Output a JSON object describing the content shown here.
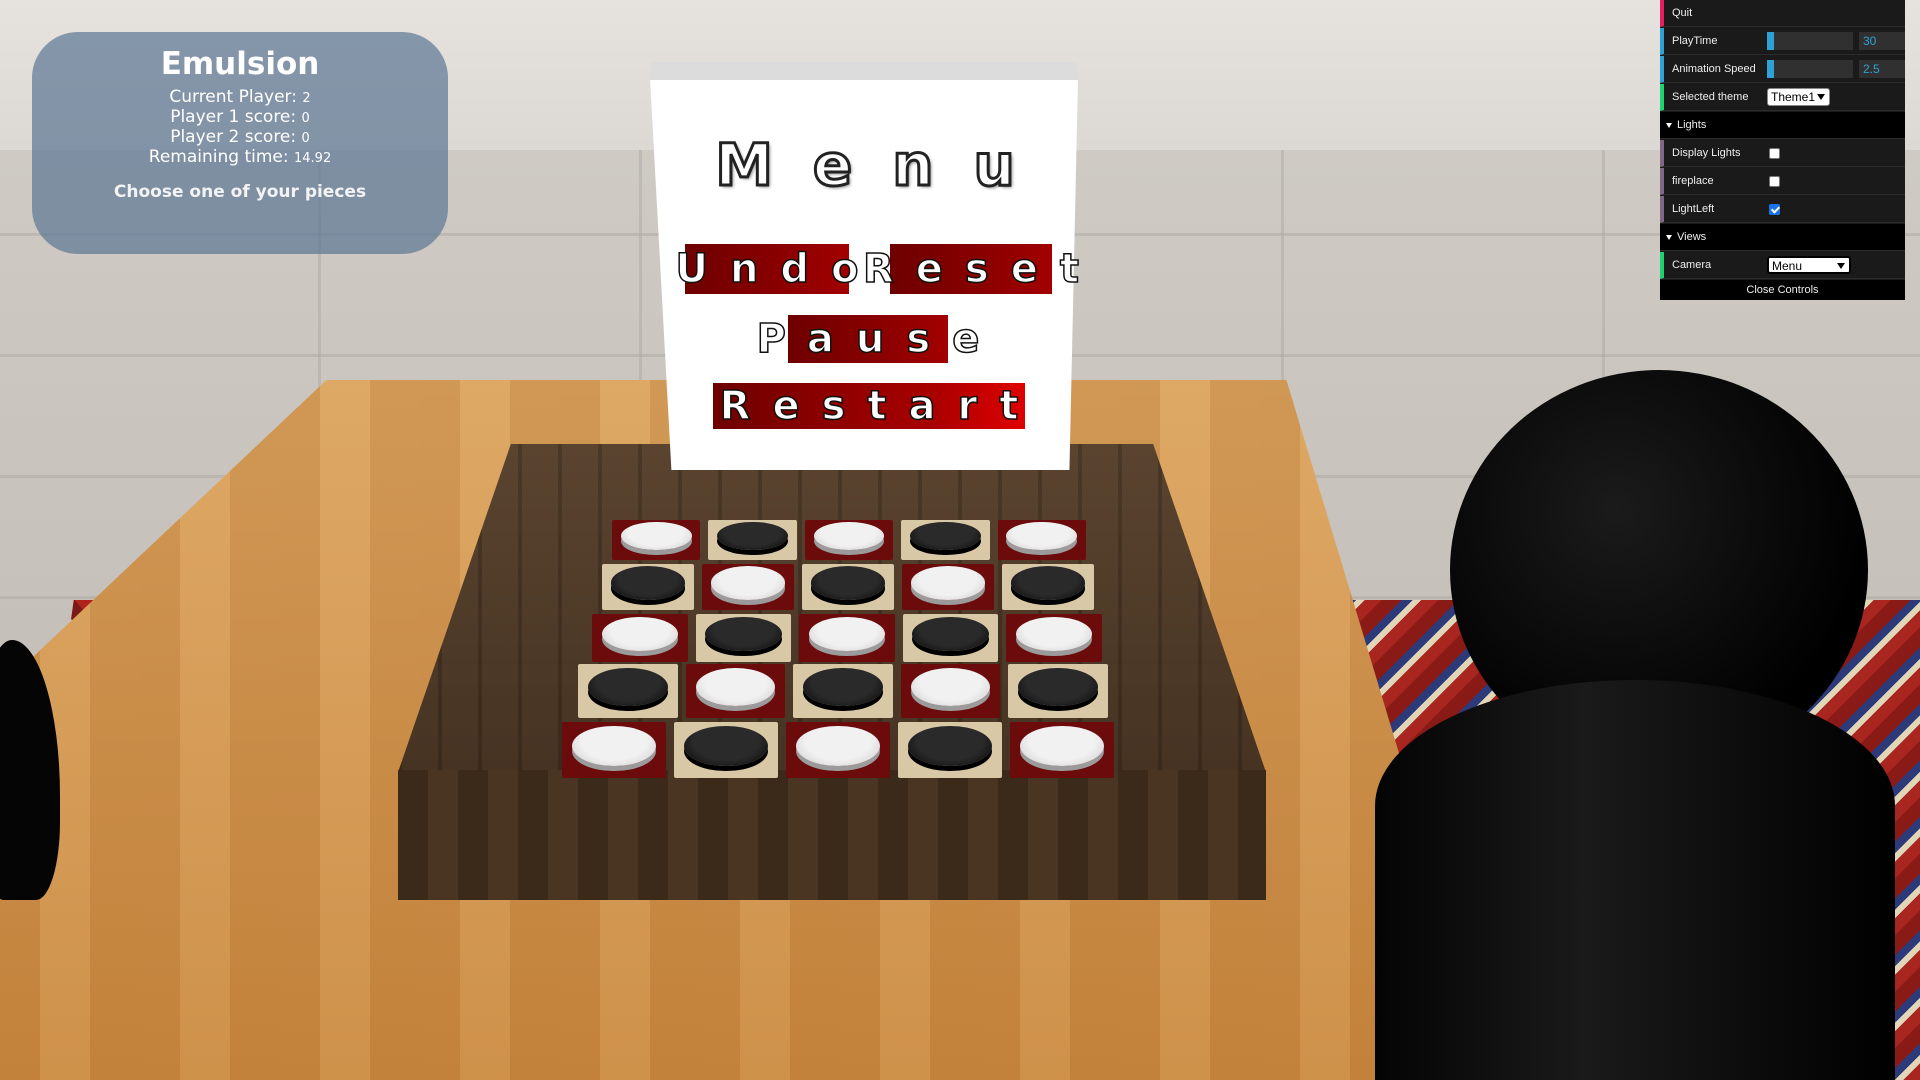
{
  "hud": {
    "title": "Emulsion",
    "current_player_label": "Current Player:",
    "current_player": "2",
    "p1_label": "Player 1 score:",
    "p1_score": "0",
    "p2_label": "Player 2 score:",
    "p2_score": "0",
    "time_label": "Remaining time:",
    "time_value": "14.92",
    "message": "Choose one of your pieces"
  },
  "menu": {
    "title": "Menu",
    "undo": "Undo",
    "reset": "Reset",
    "pause": "Pause",
    "restart": "Restart"
  },
  "controls": {
    "quit": "Quit",
    "playtime_label": "PlayTime",
    "playtime_value": "30",
    "playtime_fraction": 0.08,
    "anim_label": "Animation Speed",
    "anim_value": "2.5",
    "anim_fraction": 0.08,
    "theme_label": "Selected theme",
    "theme_value": "Theme1",
    "lights_folder": "Lights",
    "display_lights": "Display Lights",
    "display_lights_checked": false,
    "fireplace": "fireplace",
    "fireplace_checked": false,
    "lightleft": "LightLeft",
    "lightleft_checked": true,
    "views_folder": "Views",
    "camera_label": "Camera",
    "camera_value": "Menu",
    "close": "Close Controls"
  },
  "board": {
    "rows": [
      [
        "white",
        "black",
        "white",
        "black",
        "white"
      ],
      [
        "black",
        "white",
        "black",
        "white",
        "black"
      ],
      [
        "white",
        "black",
        "white",
        "black",
        "white"
      ],
      [
        "black",
        "white",
        "black",
        "white",
        "black"
      ],
      [
        "white",
        "black",
        "white",
        "black",
        "white"
      ]
    ],
    "colors": {
      "red": "#6b0b0b",
      "cream": "#d8c8a6",
      "accent": "#2fa1d6"
    }
  }
}
